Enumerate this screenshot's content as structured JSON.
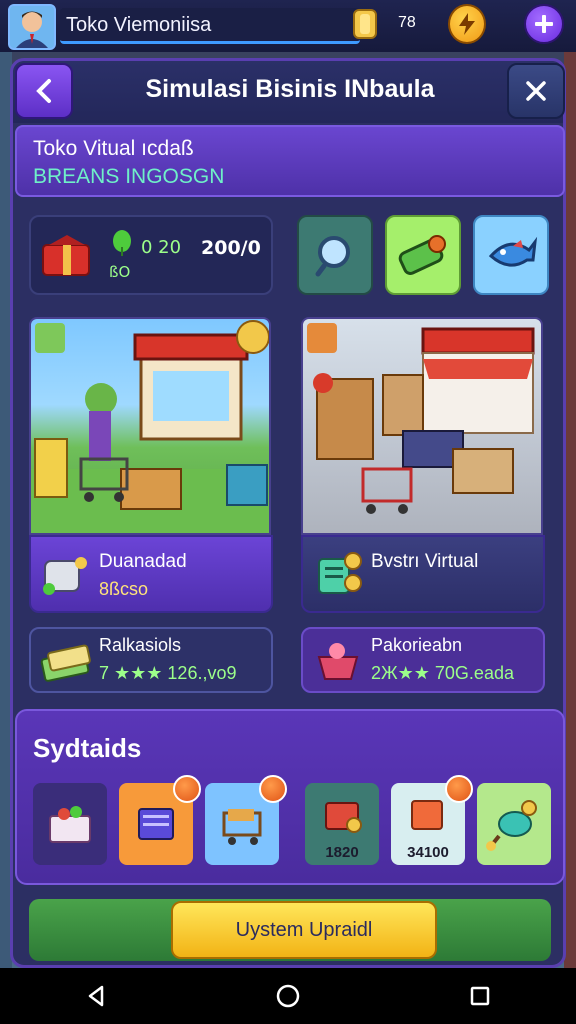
{
  "header": {
    "player_name": "Toko Viemoniisa",
    "coins": "78"
  },
  "panel": {
    "title": "Simulasi Bisinis INbaula"
  },
  "store": {
    "name": "Toko Vitual ıcdaß",
    "subtitle": "BREANS INGOSGN"
  },
  "stats": {
    "value_a": "0 20",
    "value_b": "200/0",
    "value_c": "ßO"
  },
  "businesses": [
    {
      "title": "Duanadad",
      "subtitle": "8ßcso"
    },
    {
      "title": "Bvstrı Virtual",
      "subtitle": ""
    }
  ],
  "stat_cards": [
    {
      "title": "Ralkasiols",
      "value": "7 ★★★ 126.,vo9"
    },
    {
      "title": "Pakorieabn",
      "value": "2Ж★★ 70G.eada"
    }
  ],
  "upgrades": {
    "title": "Sydtaids",
    "items": [
      {
        "price": ""
      },
      {
        "price": ""
      },
      {
        "price": ""
      },
      {
        "price": "1820"
      },
      {
        "price": "34100"
      },
      {
        "price": ""
      }
    ]
  },
  "footer": {
    "button_label": "Uystem Upraidl"
  },
  "colors": {
    "accent": "#6a46d0",
    "gold": "#f2b315",
    "green": "#9cff8a"
  }
}
